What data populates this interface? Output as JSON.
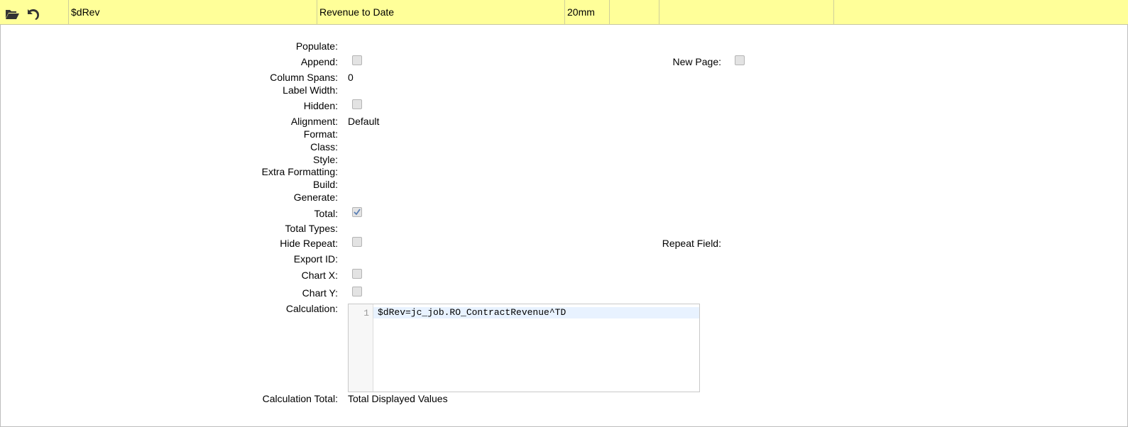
{
  "header": {
    "field_name": "$dRev",
    "description": "Revenue to Date",
    "width": "20mm",
    "col4": "",
    "col5": "",
    "col6": "",
    "col7": ""
  },
  "icons": {
    "open": "folder-open-icon",
    "undo": "undo-icon"
  },
  "form": {
    "populate": {
      "label": "Populate:",
      "value": ""
    },
    "append": {
      "label": "Append:",
      "checked": false
    },
    "new_page": {
      "label": "New Page:",
      "checked": false
    },
    "column_spans": {
      "label": "Column Spans:",
      "value": "0"
    },
    "label_width": {
      "label": "Label Width:",
      "value": ""
    },
    "hidden": {
      "label": "Hidden:",
      "checked": false
    },
    "alignment": {
      "label": "Alignment:",
      "value": "Default"
    },
    "format": {
      "label": "Format:",
      "value": ""
    },
    "class": {
      "label": "Class:",
      "value": ""
    },
    "style": {
      "label": "Style:",
      "value": ""
    },
    "extra_formatting": {
      "label": "Extra Formatting:",
      "value": ""
    },
    "build": {
      "label": "Build:",
      "value": ""
    },
    "generate": {
      "label": "Generate:",
      "value": ""
    },
    "total": {
      "label": "Total:",
      "checked": true
    },
    "total_types": {
      "label": "Total Types:",
      "value": ""
    },
    "hide_repeat": {
      "label": "Hide Repeat:",
      "checked": false
    },
    "repeat_field": {
      "label": "Repeat Field:",
      "value": ""
    },
    "export_id": {
      "label": "Export ID:",
      "value": ""
    },
    "chart_x": {
      "label": "Chart X:",
      "checked": false
    },
    "chart_y": {
      "label": "Chart Y:",
      "checked": false
    },
    "calculation": {
      "label": "Calculation:",
      "line_number": "1",
      "code": "$dRev=jc_job.RO_ContractRevenue^TD"
    },
    "calculation_total": {
      "label": "Calculation Total:",
      "value": "Total Displayed Values"
    }
  },
  "colors": {
    "header_bg": "#ffff99",
    "checkbox_bg": "#e3e3e3",
    "check_mark": "#5a7fb5"
  }
}
